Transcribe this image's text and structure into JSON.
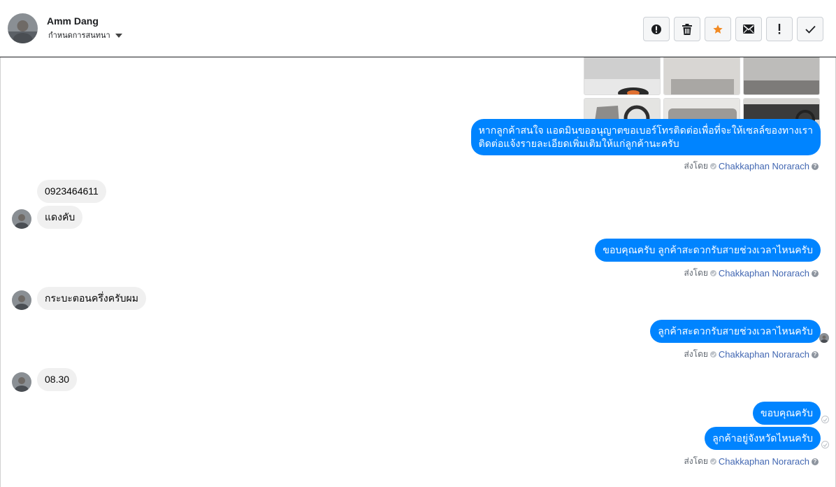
{
  "header": {
    "name": "Amm Dang",
    "subtitle": "กำหนดการสนทนา"
  },
  "toolbar": {
    "buttons": [
      {
        "icon": "alert-circle-icon"
      },
      {
        "icon": "trash-icon"
      },
      {
        "icon": "star-icon",
        "color": "#f28a22"
      },
      {
        "icon": "envelope-icon"
      },
      {
        "icon": "exclamation-icon"
      },
      {
        "icon": "check-icon"
      }
    ]
  },
  "messages": {
    "m1": "หากลูกค้าสนใจ แอดมินขออนุญาตขอเบอร์โทรติดต่อเพื่อที่จะให้เซลล์ของทางเรา",
    "m1b": "ติดต่อแจ้งรายละเอียดเพิ่มเติมให้แก่ลูกค้านะครับ",
    "m2": "0923464611",
    "m3": "แดงคับ",
    "m4": "ขอบคุณครับ ลูกค้าสะดวกรับสายช่วงเวลาไหนครับ",
    "m5": "กระบะตอนครึ่งครับผม",
    "m6": "ลูกค้าสะดวกรับสายช่วงเวลาไหนครับ",
    "m7": "08.30",
    "m8": "ขอบคุณครับ",
    "m9": "ลูกค้าอยู่จังหวัดไหนครับ"
  },
  "sent_by": {
    "label": "ส่งโดย",
    "agent": "Chakkaphan Norarach"
  },
  "colors": {
    "outgoing": "#0084ff",
    "incoming": "#f0f0f0",
    "agent_link": "#4267b2"
  }
}
